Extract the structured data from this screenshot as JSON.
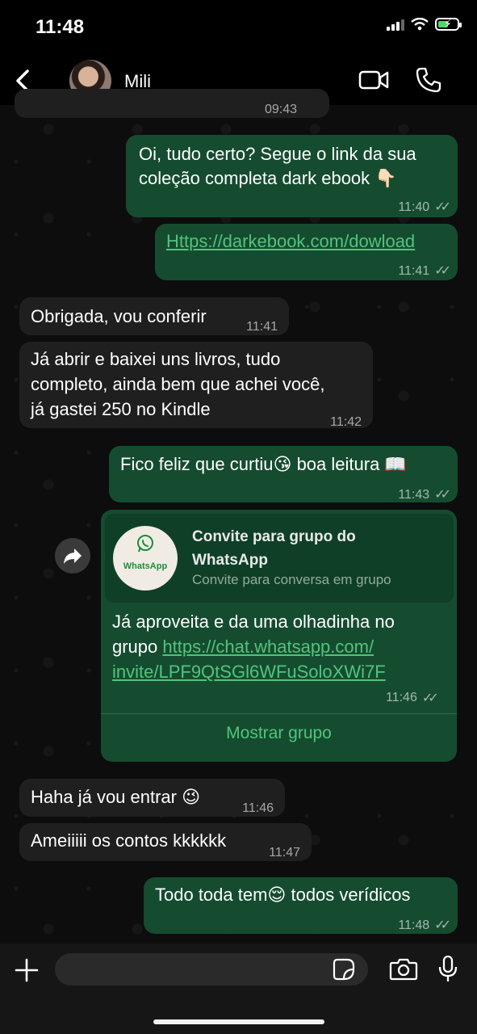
{
  "status_bar": {
    "time": "11:48"
  },
  "header": {
    "contact_name": "Mili"
  },
  "messages": [
    {
      "id": "m0",
      "direction": "in",
      "text": "",
      "time": "09:43"
    },
    {
      "id": "m1",
      "direction": "out",
      "text_lines": [
        "Oi, tudo certo? Segue o link da sua",
        "coleção completa dark ebook 👇🏻"
      ],
      "time": "11:40"
    },
    {
      "id": "m2",
      "direction": "out",
      "link": "Https://darkebook.com/dowload",
      "time": "11:41"
    },
    {
      "id": "m3",
      "direction": "in",
      "text": "Obrigada, vou conferir",
      "time": "11:41"
    },
    {
      "id": "m4",
      "direction": "in",
      "text_lines": [
        "Já abrir e baixei uns livros, tudo",
        "completo, ainda bem que achei você,",
        "já gastei 250 no Kindle"
      ],
      "time": "11:42"
    },
    {
      "id": "m5",
      "direction": "out",
      "text": "Fico feliz que curtiu😘 boa leitura 📖",
      "time": "11:43"
    },
    {
      "id": "m6",
      "direction": "out",
      "card": {
        "logo_label": "WhatsApp",
        "title": "Convite para grupo do WhatsApp",
        "subtitle": "Convite para conversa em grupo"
      },
      "text_prefix": "Já aproveita e da uma olhadinha no",
      "text_line2_prefix": "grupo ",
      "link_line1": "https://chat.whatsapp.com/",
      "link_line2": "invite/LPF9QtSGl6WFuSoloXWi7F",
      "time": "11:46",
      "action": "Mostrar grupo"
    },
    {
      "id": "m7",
      "direction": "in",
      "text": "Haha já vou entrar 😉",
      "time": "11:46"
    },
    {
      "id": "m8",
      "direction": "in",
      "text": "Ameiiiii os contos kkkkkk",
      "time": "11:47"
    },
    {
      "id": "m9",
      "direction": "out",
      "text": "Todo toda tem😌 todos verídicos",
      "time": "11:48"
    }
  ],
  "composer": {
    "placeholder": ""
  }
}
